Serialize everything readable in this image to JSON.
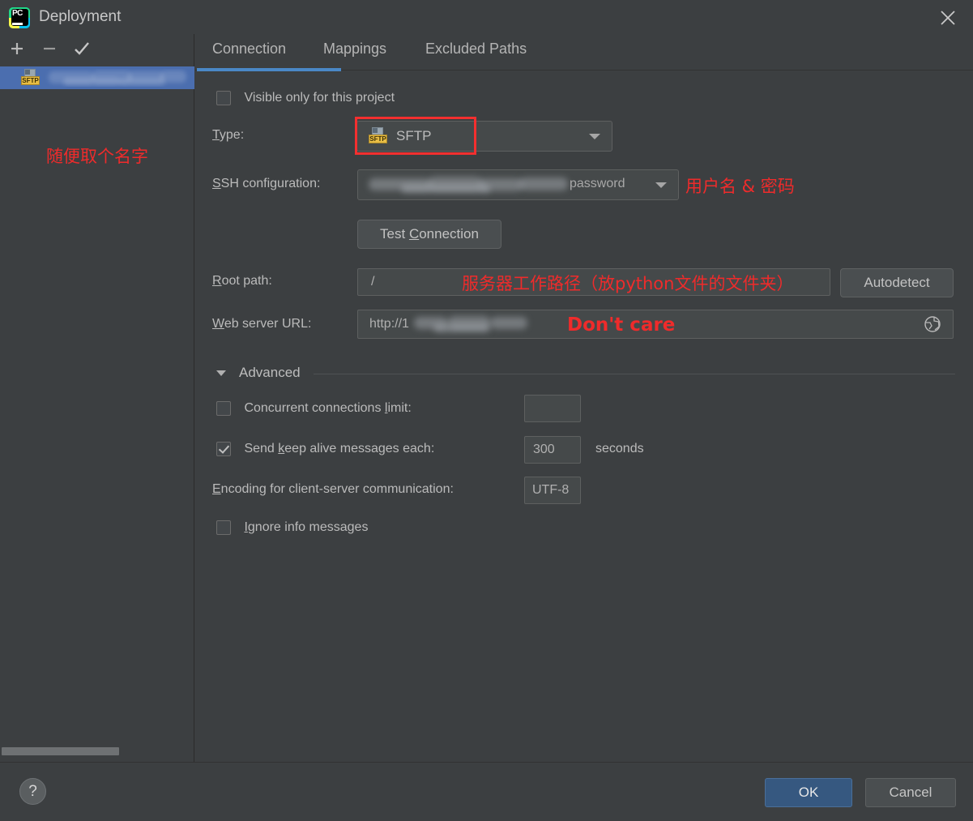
{
  "window": {
    "title": "Deployment",
    "logo_icon": "pycharm-logo-icon",
    "logo_text": "PC",
    "close_icon": "close-icon"
  },
  "sidebar": {
    "toolbar": {
      "add_icon": "plus-icon",
      "remove_icon": "minus-icon",
      "set_default_icon": "checkmark-icon"
    },
    "server": {
      "type_badge": "SFTP",
      "name": "",
      "redacted": true
    },
    "annotation": "随便取个名字",
    "scrollbar": "horizontal-scrollbar"
  },
  "tabs": [
    {
      "label": "Connection",
      "active": true
    },
    {
      "label": "Mappings",
      "active": false
    },
    {
      "label": "Excluded Paths",
      "active": false
    }
  ],
  "connection": {
    "visible_only": {
      "label": "Visible only for this project",
      "checked": false
    },
    "type": {
      "label": "Type:",
      "label_mnemonic": "T",
      "value": "SFTP",
      "icon": "sftp-type-icon",
      "highlighted": true
    },
    "ssh_configuration": {
      "label": "SSH configuration:",
      "label_mnemonic": "S",
      "value_prefix": "dup...g@1",
      "value_suffix": "password",
      "redacted": true,
      "annotation": "用户名 & 密码"
    },
    "test_connection": {
      "label": "Test Connection",
      "label_mnemonic": "C"
    },
    "root_path": {
      "label": "Root path:",
      "label_mnemonic": "R",
      "value": "/",
      "annotation": "服务器工作路径（放python文件的文件夹）",
      "autodetect_label": "Autodetect"
    },
    "web_server_url": {
      "label": "Web server URL:",
      "label_mnemonic": "W",
      "value": "http://1",
      "redacted": true,
      "annotation": "Don't care",
      "open_icon": "globe-icon"
    }
  },
  "advanced": {
    "title": "Advanced",
    "expanded": true,
    "concurrent_connections": {
      "label": "Concurrent connections limit:",
      "label_mnemonic": "l",
      "checked": false,
      "value": ""
    },
    "keep_alive": {
      "label": "Send keep alive messages each:",
      "label_mnemonic": "k",
      "checked": true,
      "value": "300",
      "unit": "seconds"
    },
    "encoding": {
      "label": "Encoding for client-server communication:",
      "label_mnemonic": "E",
      "value": "UTF-8"
    },
    "ignore_info": {
      "label": "Ignore info messages",
      "label_mnemonic": "I",
      "checked": false
    }
  },
  "footer": {
    "help_label": "?",
    "ok_label": "OK",
    "cancel_label": "Cancel"
  },
  "colors": {
    "background": "#3c3f41",
    "accent_blue": "#4a88c7",
    "selection_blue": "#4b6eaf",
    "ok_button": "#365880",
    "annotation_red": "#ef2b2b",
    "highlight_red": "#f42f2f",
    "sftp_badge": "#e8bd45"
  }
}
